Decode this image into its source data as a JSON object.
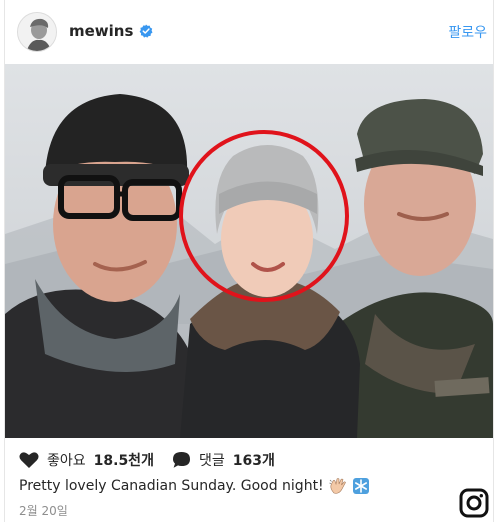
{
  "post": {
    "username": "mewins",
    "verified_icon": "verified-badge-icon",
    "follow_label": "팔로우",
    "likes_label": "좋아요",
    "likes_count": "18.5천개",
    "comments_label": "댓글",
    "comments_count": "163개",
    "caption": "Pretty lovely Canadian Sunday. Good night!",
    "caption_emojis": [
      "waving-hand-icon",
      "snowflake-icon"
    ],
    "date": "2월 20일"
  },
  "icons": {
    "like": "heart-icon",
    "comment": "comment-bubble-icon",
    "brand": "instagram-logo-icon"
  },
  "colors": {
    "link_blue": "#3897f0",
    "highlight_circle": "#e0131b",
    "verified": "#3897f0",
    "date_gray": "#8e8e8e"
  }
}
